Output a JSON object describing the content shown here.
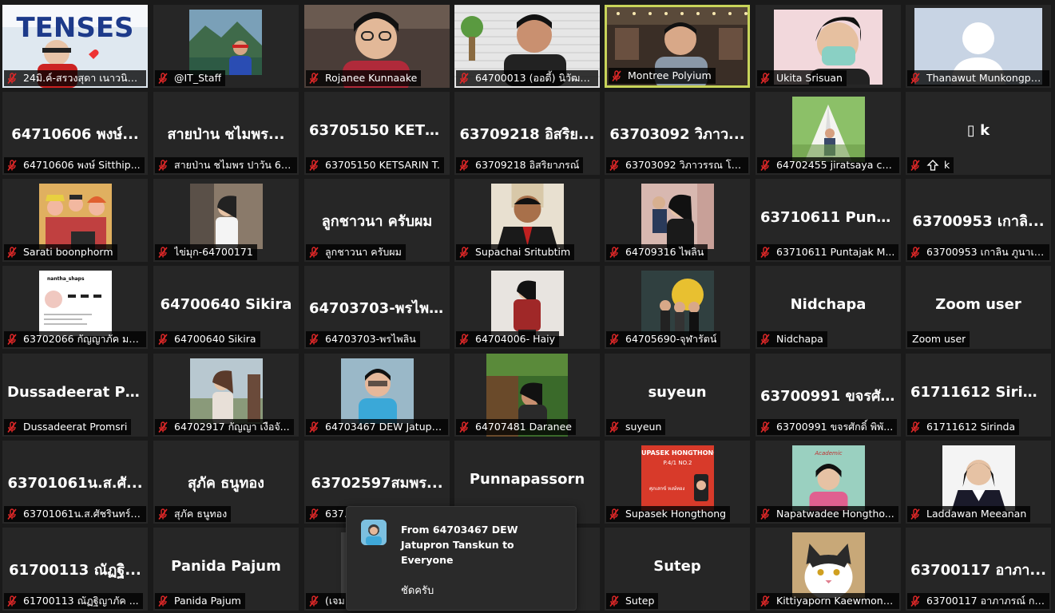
{
  "participants": [
    {
      "name": "24มิ.ค์-สรวงสุดา เนาวนิต...",
      "kind": "video",
      "scene": "tenses"
    },
    {
      "name": "@IT_Staff",
      "kind": "photo",
      "scene": "landscape"
    },
    {
      "name": "Rojanee Kunnaake",
      "kind": "video",
      "scene": "woman-glasses"
    },
    {
      "name": "64700013 (ออดี้) นิวัฒน์...",
      "kind": "video",
      "scene": "man-brick"
    },
    {
      "name": "Montree Polyium",
      "kind": "video",
      "scene": "man-cafe",
      "active": true
    },
    {
      "name": "Ukita Srisuan",
      "kind": "video",
      "scene": "woman-mask"
    },
    {
      "name": "Thanawut Munkongpe...",
      "kind": "photo",
      "scene": "silhouette"
    },
    {
      "name": "64710606 พงษ์ Sitthip...",
      "kind": "name",
      "display": "64710606  พงษ์..."
    },
    {
      "name": "สายป่าน ชไมพร ปาวัน 64...",
      "kind": "name",
      "display": "สายป่าน ชไมพร..."
    },
    {
      "name": "63705150 KETSARIN T.",
      "kind": "name",
      "display": "63705150  KETS..."
    },
    {
      "name": "63709218 อิสริยาภรณ์",
      "kind": "name",
      "display": "63709218 อิสริย..."
    },
    {
      "name": "63703092 วิภาวรรณ โพ...",
      "kind": "name",
      "display": "63703092 วิภาว..."
    },
    {
      "name": "64702455 jiratsaya ch...",
      "kind": "photo",
      "scene": "tent"
    },
    {
      "name": "k",
      "kind": "name",
      "display": "▯ k",
      "icon": "up-arrow"
    },
    {
      "name": "Sarati boonphorm",
      "kind": "photo",
      "scene": "anime"
    },
    {
      "name": "ไข่มุก-64700171",
      "kind": "photo",
      "scene": "girl-white"
    },
    {
      "name": "ลูกชาวนา ครับผม",
      "kind": "name",
      "display": "ลูกชาวนา ครับผม"
    },
    {
      "name": "Supachai Sritubtim",
      "kind": "photo",
      "scene": "man-suit"
    },
    {
      "name": "64709316 ไพลิน",
      "kind": "photo",
      "scene": "girl-black"
    },
    {
      "name": "63710611 Puntajak M...",
      "kind": "name",
      "display": "63710611  Punta..."
    },
    {
      "name": "63700953 เกาลิน ภูนาเงิน",
      "kind": "name",
      "display": "63700953 เกาลิ..."
    },
    {
      "name": "63702066 กัญญาภัค มง...",
      "kind": "photo",
      "scene": "instagram"
    },
    {
      "name": "64700640 Sikira",
      "kind": "name",
      "display": "64700640 Sikira"
    },
    {
      "name": "64703703-พรไพลิน",
      "kind": "name",
      "display": "64703703-พรไพ..."
    },
    {
      "name": "64704006- Haiy",
      "kind": "photo",
      "scene": "girl-red"
    },
    {
      "name": "64705690-จุฬารัตน์",
      "kind": "photo",
      "scene": "group-yellow"
    },
    {
      "name": "Nidchapa",
      "kind": "name",
      "display": "Nidchapa"
    },
    {
      "name": "Zoom user",
      "kind": "name",
      "display": "Zoom user",
      "nomic": true
    },
    {
      "name": "Dussadeerat Promsri",
      "kind": "name",
      "display": "Dussadeerat  Pr..."
    },
    {
      "name": "64702917 กัญญา  เงือจั...",
      "kind": "photo",
      "scene": "girl-outdoor"
    },
    {
      "name": "64703467 DEW Jatupr...",
      "kind": "photo",
      "scene": "boy-blue"
    },
    {
      "name": "64707481 Daranee",
      "kind": "video",
      "scene": "green-room"
    },
    {
      "name": "suyeun",
      "kind": "name",
      "display": "suyeun"
    },
    {
      "name": "63700991 ขจรศักดิ์ พิพั...",
      "kind": "name",
      "display": "63700991  ขจรศั..."
    },
    {
      "name": "61711612 Sirinda",
      "kind": "name",
      "display": "61711612 Sirinda"
    },
    {
      "name": "63701061น.ส.ศัชรินทร์ ...",
      "kind": "name",
      "display": "63701061น.ส.ศั..."
    },
    {
      "name": "สุภัค ธนูทอง",
      "kind": "name",
      "display": "สุภัค ธนูทอง"
    },
    {
      "name": "637...",
      "kind": "name",
      "display": "63702597สมพร..."
    },
    {
      "name": "Punnapassorn",
      "kind": "name",
      "display": "Punnapassorn",
      "nolabel": true
    },
    {
      "name": "Supasek Hongthong",
      "kind": "photo",
      "scene": "red-card"
    },
    {
      "name": "Napatwadee Hongtho...",
      "kind": "photo",
      "scene": "teacher-card"
    },
    {
      "name": "Laddawan Meeanan",
      "kind": "photo",
      "scene": "woman-formal"
    },
    {
      "name": "61700113 ณัฏฐิญาภัค ...",
      "kind": "name",
      "display": "61700113  ณัฏฐิ..."
    },
    {
      "name": "Panida Pajum",
      "kind": "name",
      "display": "Panida Pajum"
    },
    {
      "name": "(เจม",
      "kind": "photo",
      "scene": "partial"
    },
    {
      "name": "",
      "kind": "empty"
    },
    {
      "name": "Sutep",
      "kind": "name",
      "display": "Sutep"
    },
    {
      "name": "Kittiyaporn Kaewmong...",
      "kind": "photo",
      "scene": "cat"
    },
    {
      "name": "63700117 อาภาภรณ์ กา...",
      "kind": "name",
      "display": "63700117  อาภา..."
    }
  ],
  "photo_text": {
    "tenses_banner": "TENSES",
    "card_name": "SUPASEK HONGTHONG",
    "card_class": "P.4/1 NO.2",
    "card_thai": "ศุภเสกข์ หงษ์ทอง",
    "ig_handle": "nantha_shaps",
    "teacher_banner": "Academic"
  },
  "chat": {
    "from": "From 64703467 DEW Jatupron Tanskun to Everyone",
    "message": "ชัดครับ"
  },
  "colors": {
    "background": "#1a1a1a",
    "tile": "#262626",
    "active_border": "#c8d45a",
    "muted_icon": "#e02828"
  }
}
